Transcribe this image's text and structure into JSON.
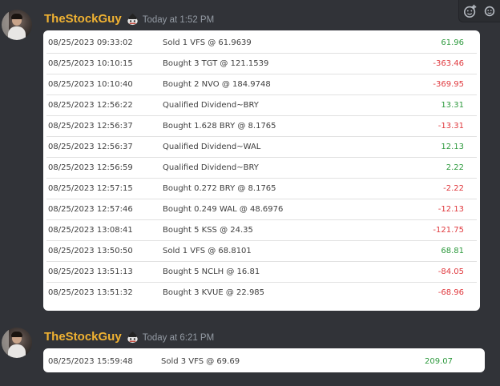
{
  "toolbar": {
    "icons": [
      "add-reaction-icon",
      "more-icon"
    ]
  },
  "messages": [
    {
      "username": "TheStockGuy",
      "timestamp": "Today at 1:52 PM",
      "rows": [
        {
          "date": "08/25/2023  09:33:02",
          "description": "Sold 1 VFS @ 61.9639",
          "amount": "61.96",
          "sign": "pos"
        },
        {
          "date": "08/25/2023  10:10:15",
          "description": "Bought 3 TGT @ 121.1539",
          "amount": "-363.46",
          "sign": "neg"
        },
        {
          "date": "08/25/2023  10:10:40",
          "description": "Bought 2 NVO @ 184.9748",
          "amount": "-369.95",
          "sign": "neg"
        },
        {
          "date": "08/25/2023  12:56:22",
          "description": "Qualified Dividend~BRY",
          "amount": "13.31",
          "sign": "pos"
        },
        {
          "date": "08/25/2023  12:56:37",
          "description": "Bought 1.628 BRY @ 8.1765",
          "amount": "-13.31",
          "sign": "neg"
        },
        {
          "date": "08/25/2023  12:56:37",
          "description": "Qualified Dividend~WAL",
          "amount": "12.13",
          "sign": "pos"
        },
        {
          "date": "08/25/2023  12:56:59",
          "description": "Qualified Dividend~BRY",
          "amount": "2.22",
          "sign": "pos"
        },
        {
          "date": "08/25/2023  12:57:15",
          "description": "Bought 0.272 BRY @ 8.1765",
          "amount": "-2.22",
          "sign": "neg"
        },
        {
          "date": "08/25/2023  12:57:46",
          "description": "Bought 0.249 WAL @ 48.6976",
          "amount": "-12.13",
          "sign": "neg"
        },
        {
          "date": "08/25/2023  13:08:41",
          "description": "Bought 5 KSS @ 24.35",
          "amount": "-121.75",
          "sign": "neg"
        },
        {
          "date": "08/25/2023  13:50:50",
          "description": "Sold 1 VFS @ 68.8101",
          "amount": "68.81",
          "sign": "pos"
        },
        {
          "date": "08/25/2023  13:51:13",
          "description": "Bought 5 NCLH @ 16.81",
          "amount": "-84.05",
          "sign": "neg"
        },
        {
          "date": "08/25/2023  13:51:32",
          "description": "Bought 3 KVUE @ 22.985",
          "amount": "-68.96",
          "sign": "neg"
        }
      ]
    },
    {
      "username": "TheStockGuy",
      "timestamp": "Today at 6:21 PM",
      "rows": [
        {
          "date": "08/25/2023  15:59:48",
          "description": "Sold 3 VFS @ 69.69",
          "amount": "209.07",
          "sign": "pos"
        }
      ]
    }
  ],
  "colors": {
    "background": "#313338",
    "username": "#f0b232",
    "timestamp": "#949ba4",
    "positive": "#2e9a3e",
    "negative": "#e0393e"
  }
}
